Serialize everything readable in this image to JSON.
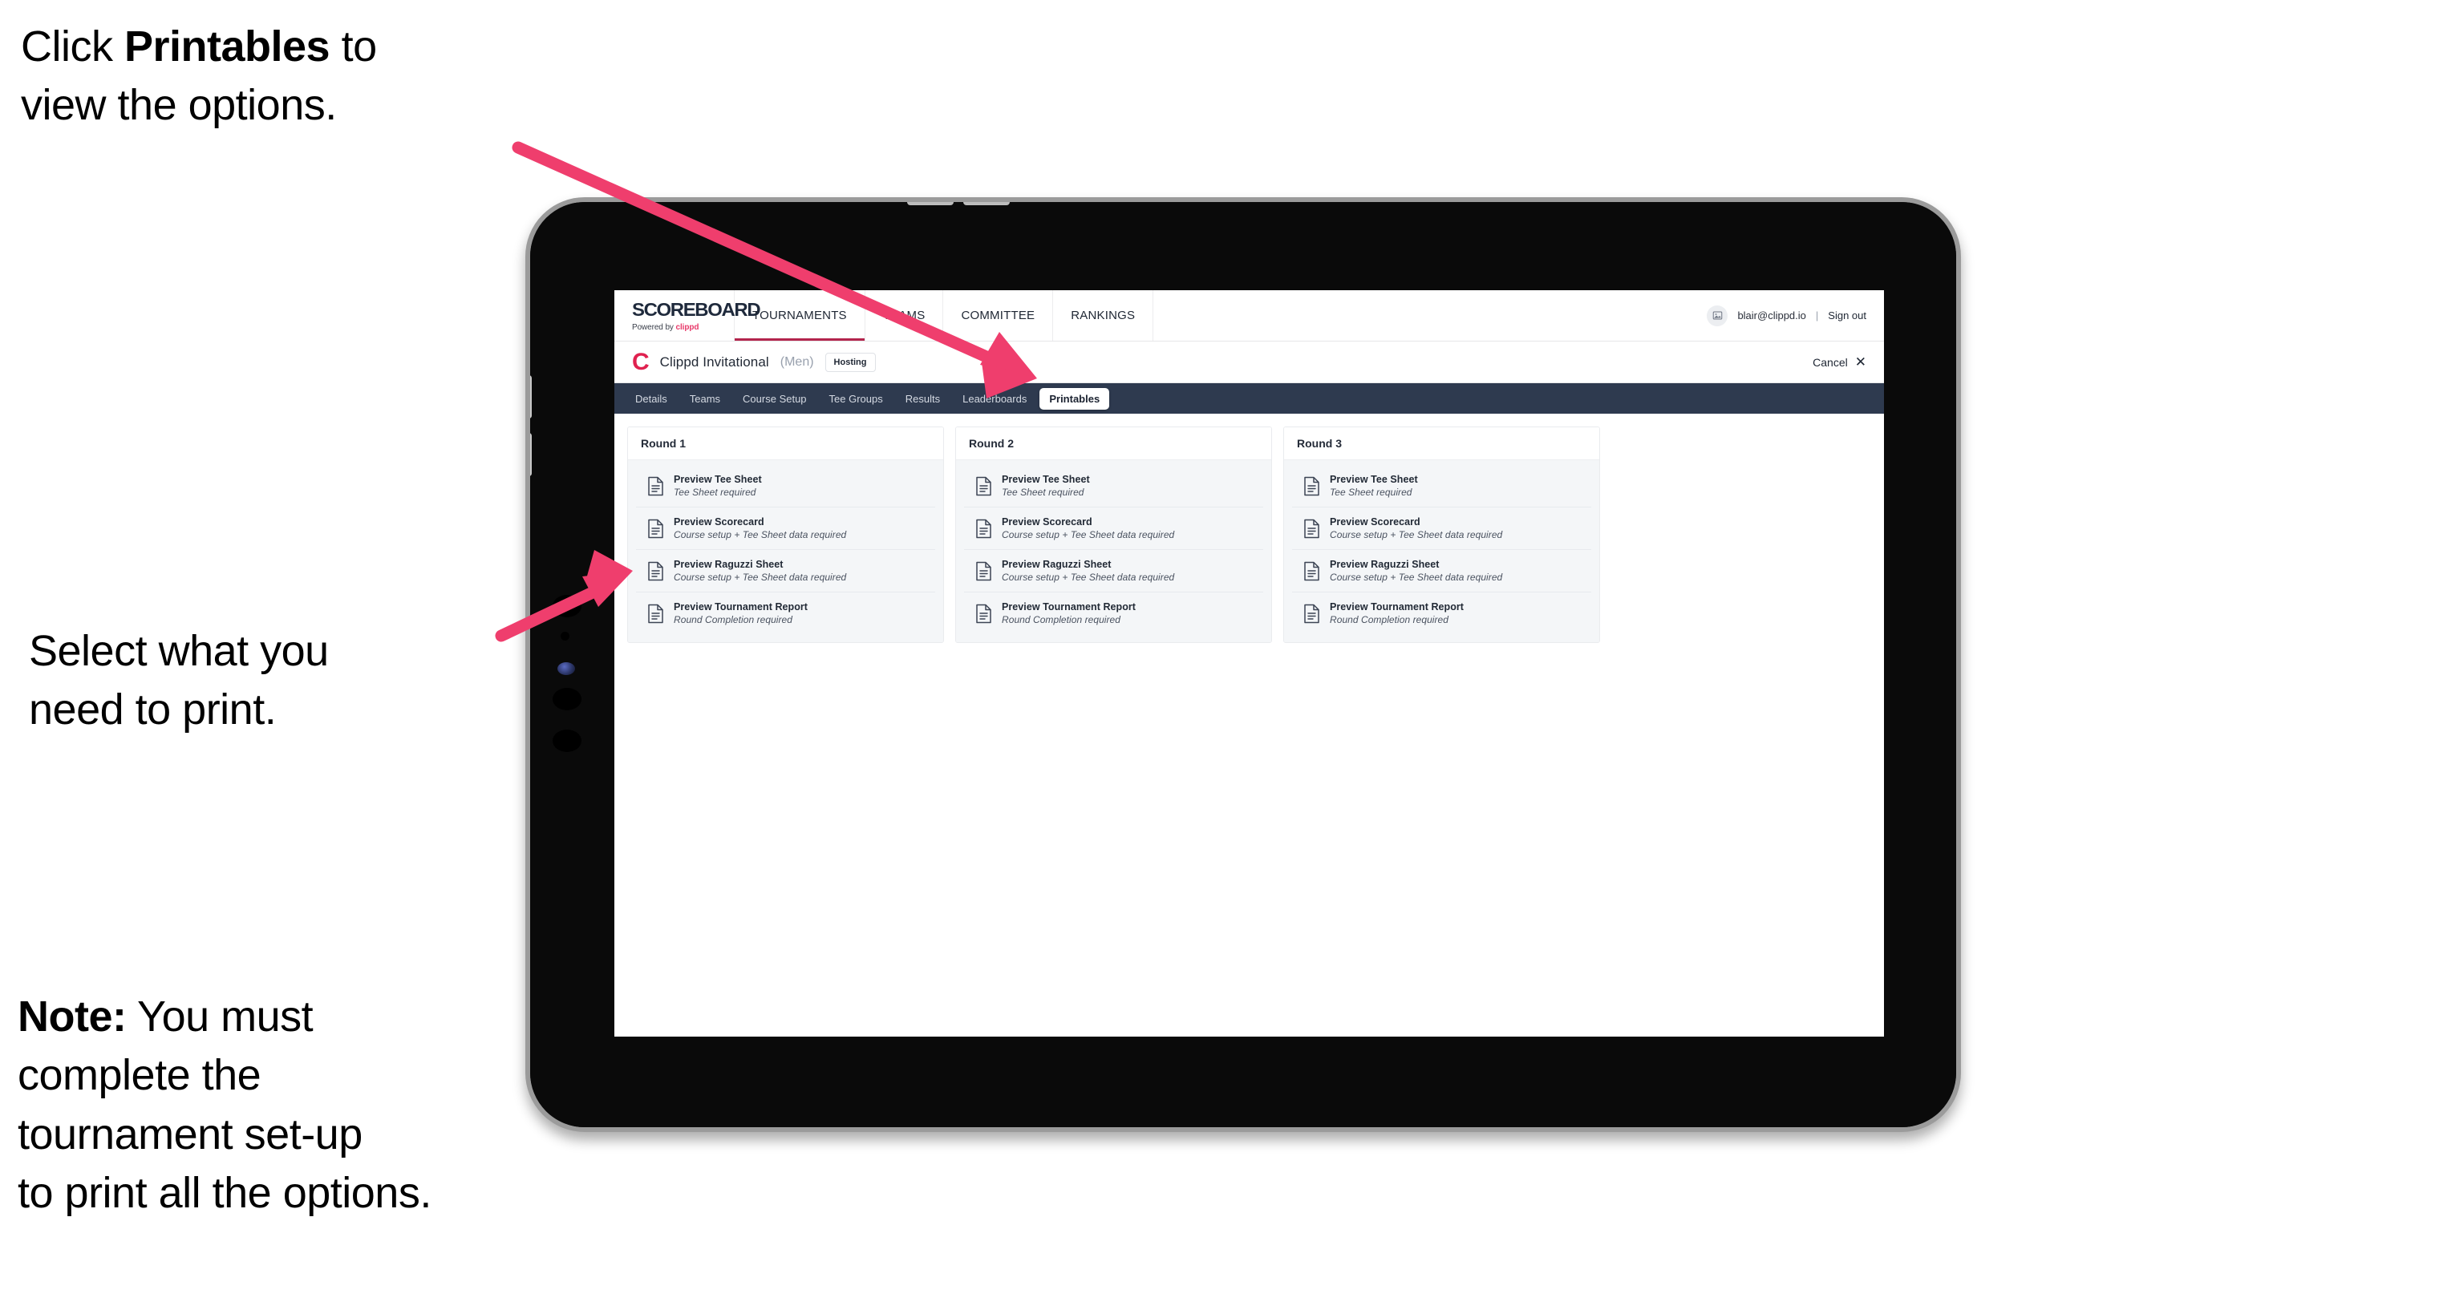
{
  "annotations": {
    "click_printables": {
      "prefix": "Click ",
      "bold": "Printables",
      "suffix": " to\nview the options."
    },
    "select_print": "Select what you\n need to print.",
    "note": {
      "bold": "Note:",
      "body": " You must\ncomplete the\ntournament set-up\nto print all the options."
    }
  },
  "app": {
    "logo": {
      "wordmark": "SCOREBOARD",
      "powered_by": "Powered by ",
      "brand": "clippd"
    },
    "mainnav": [
      {
        "label": "TOURNAMENTS",
        "active": true
      },
      {
        "label": "TEAMS",
        "active": false
      },
      {
        "label": "COMMITTEE",
        "active": false
      },
      {
        "label": "RANKINGS",
        "active": false
      }
    ],
    "account": {
      "avatar_icon": "user-image-icon",
      "email": "blair@clippd.io",
      "separator": "|",
      "sign_out": "Sign out"
    },
    "tournament": {
      "mark": "C",
      "name": "Clippd Invitational",
      "gender": "(Men)",
      "status_badge": "Hosting",
      "cancel_label": "Cancel",
      "cancel_icon": "close-icon"
    },
    "tabs": [
      {
        "label": "Details",
        "active": false
      },
      {
        "label": "Teams",
        "active": false
      },
      {
        "label": "Course Setup",
        "active": false
      },
      {
        "label": "Tee Groups",
        "active": false
      },
      {
        "label": "Results",
        "active": false
      },
      {
        "label": "Leaderboards",
        "active": false
      },
      {
        "label": "Printables",
        "active": true
      }
    ],
    "rounds": [
      {
        "title": "Round 1",
        "items": [
          {
            "icon": "document-icon",
            "title": "Preview Tee Sheet",
            "requirement": "Tee Sheet required"
          },
          {
            "icon": "document-icon",
            "title": "Preview Scorecard",
            "requirement": "Course setup + Tee Sheet data required"
          },
          {
            "icon": "document-icon",
            "title": "Preview Raguzzi Sheet",
            "requirement": "Course setup + Tee Sheet data required"
          },
          {
            "icon": "document-icon",
            "title": "Preview Tournament Report",
            "requirement": "Round Completion required"
          }
        ]
      },
      {
        "title": "Round 2",
        "items": [
          {
            "icon": "document-icon",
            "title": "Preview Tee Sheet",
            "requirement": "Tee Sheet required"
          },
          {
            "icon": "document-icon",
            "title": "Preview Scorecard",
            "requirement": "Course setup + Tee Sheet data required"
          },
          {
            "icon": "document-icon",
            "title": "Preview Raguzzi Sheet",
            "requirement": "Course setup + Tee Sheet data required"
          },
          {
            "icon": "document-icon",
            "title": "Preview Tournament Report",
            "requirement": "Round Completion required"
          }
        ]
      },
      {
        "title": "Round 3",
        "items": [
          {
            "icon": "document-icon",
            "title": "Preview Tee Sheet",
            "requirement": "Tee Sheet required"
          },
          {
            "icon": "document-icon",
            "title": "Preview Scorecard",
            "requirement": "Course setup + Tee Sheet data required"
          },
          {
            "icon": "document-icon",
            "title": "Preview Raguzzi Sheet",
            "requirement": "Course setup + Tee Sheet data required"
          },
          {
            "icon": "document-icon",
            "title": "Preview Tournament Report",
            "requirement": "Round Completion required"
          }
        ]
      }
    ]
  },
  "colors": {
    "accent_pink": "#ef3e6d",
    "brand_red": "#e0214f",
    "tabbar_navy": "#2e3a4f",
    "nav_underline": "#b3254d"
  }
}
